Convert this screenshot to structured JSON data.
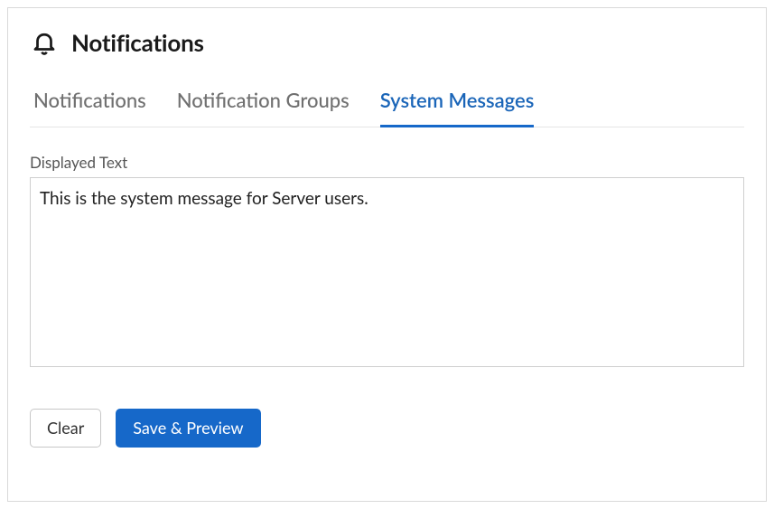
{
  "header": {
    "title": "Notifications",
    "icon": "bell-icon"
  },
  "tabs": [
    {
      "label": "Notifications",
      "active": false
    },
    {
      "label": "Notification Groups",
      "active": false
    },
    {
      "label": "System Messages",
      "active": true
    }
  ],
  "field": {
    "label": "Displayed Text",
    "value": "This is the system message for Server users."
  },
  "actions": {
    "clear_label": "Clear",
    "save_preview_label": "Save & Preview"
  }
}
